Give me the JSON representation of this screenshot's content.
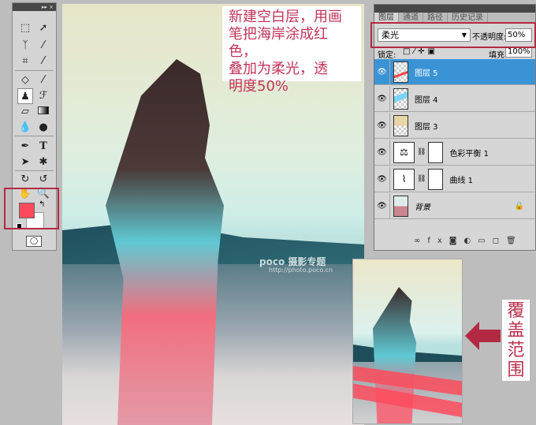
{
  "toolbox": {
    "header": "▸▸ ×",
    "colors": {
      "foreground": "#fd4b5c",
      "background": "#ffffff"
    }
  },
  "annotation": {
    "text_lines": [
      "新建空白层，用画",
      "笔把海岸涂成红色，",
      "叠加为柔光，透",
      "明度50%"
    ],
    "coverage_label": "覆盖范围",
    "accent": "#b22a42"
  },
  "watermark": {
    "brand": "poco 摄影专题",
    "url": "http://photo.poco.cn"
  },
  "layers_panel": {
    "tabs": [
      "图层",
      "通道",
      "路径",
      "历史记录"
    ],
    "blend_mode": "柔光",
    "opacity_label": "不透明度:",
    "opacity": "50%",
    "lock_label": "锁定:",
    "fill_label": "填充:",
    "fill": "100%",
    "layers": [
      {
        "name": "图层 5",
        "selected": true
      },
      {
        "name": "图层 4"
      },
      {
        "name": "图层 3"
      },
      {
        "name": "色彩平衡 1",
        "adjustment": true
      },
      {
        "name": "曲线 1",
        "adjustment": true
      },
      {
        "name": "背景",
        "locked": true
      }
    ],
    "footer_icons": [
      "link-icon",
      "fx-icon",
      "mask-icon",
      "adjustment-icon",
      "folder-icon",
      "new-layer-icon",
      "trash-icon"
    ]
  }
}
